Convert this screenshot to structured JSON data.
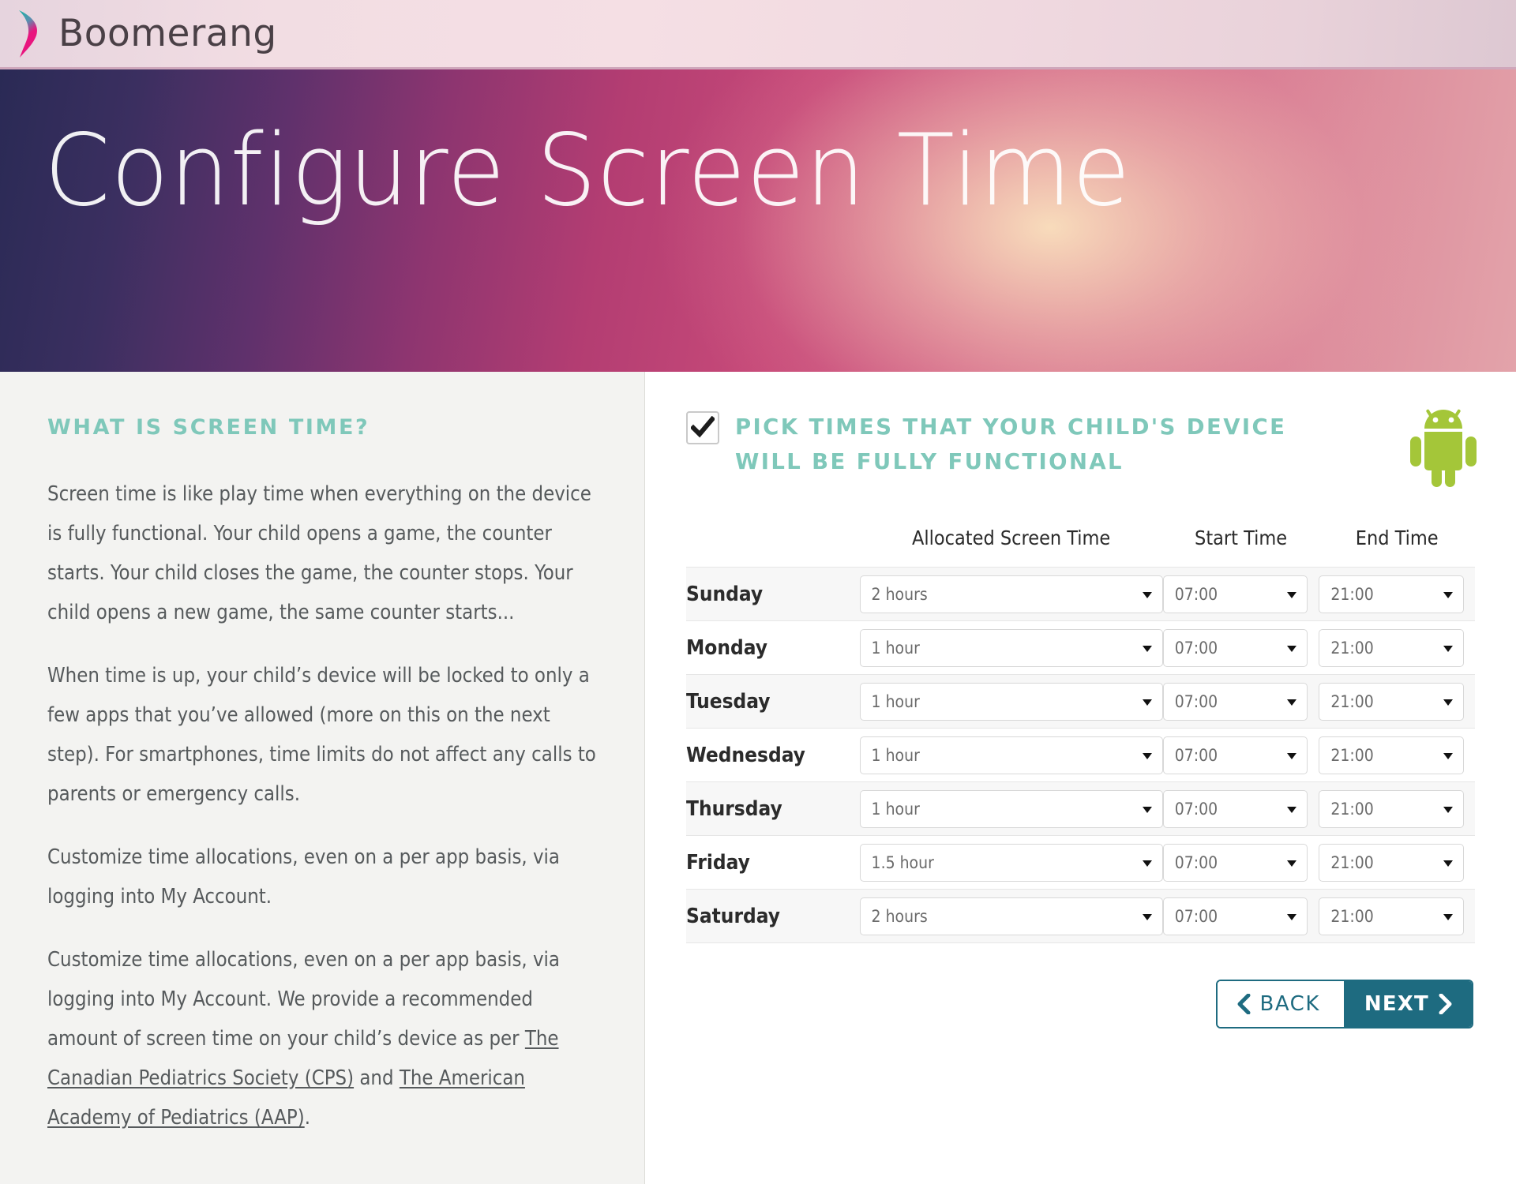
{
  "brand": {
    "name": "Boomerang",
    "logo_icon": "boomerang-crescent-icon"
  },
  "hero": {
    "title": "Configure Screen Time"
  },
  "sidebar": {
    "heading": "WHAT IS SCREEN TIME?",
    "paragraphs": [
      "Screen time is like play time when everything on the device is fully functional. Your child opens a game, the counter starts. Your child closes the game, the counter stops. Your child opens a new game, the same counter starts...",
      "When time is up, your child’s device will be locked to only a few apps that you’ve allowed (more on this on the next step). For smartphones, time limits do not affect any calls to parents or emergency calls.",
      "Customize time allocations, even on a per app basis, via logging into My Account."
    ],
    "last_paragraph": {
      "pre": "Customize time allocations, even on a per app basis, via logging into My Account. We provide a recommended amount of screen time on your child’s device as per ",
      "link1": "The Canadian Pediatrics Society (CPS)",
      "mid": " and ",
      "link2": "The American Academy of Pediatrics (AAP)",
      "post": "."
    }
  },
  "panel": {
    "checkbox_checked": true,
    "checkbox_icon": "checkmark-icon",
    "title": "PICK TIMES THAT YOUR CHILD'S DEVICE WILL BE FULLY FUNCTIONAL",
    "platform_icon": "android-robot-icon",
    "platform_icon_color": "#a4c639"
  },
  "table": {
    "columns": [
      "",
      "Allocated Screen Time",
      "Start Time",
      "End Time"
    ],
    "rows": [
      {
        "day": "Sunday",
        "allocated": "2 hours",
        "start": "07:00",
        "end": "21:00"
      },
      {
        "day": "Monday",
        "allocated": "1 hour",
        "start": "07:00",
        "end": "21:00"
      },
      {
        "day": "Tuesday",
        "allocated": "1 hour",
        "start": "07:00",
        "end": "21:00"
      },
      {
        "day": "Wednesday",
        "allocated": "1 hour",
        "start": "07:00",
        "end": "21:00"
      },
      {
        "day": "Thursday",
        "allocated": "1 hour",
        "start": "07:00",
        "end": "21:00"
      },
      {
        "day": "Friday",
        "allocated": "1.5 hour",
        "start": "07:00",
        "end": "21:00"
      },
      {
        "day": "Saturday",
        "allocated": "2 hours",
        "start": "07:00",
        "end": "21:00"
      }
    ]
  },
  "nav": {
    "back_label": "BACK",
    "next_label": "NEXT",
    "back_icon": "chevron-left-icon",
    "next_icon": "chevron-right-icon",
    "accent_color": "#1e6b80"
  },
  "colors": {
    "teal_heading": "#7fc8ba",
    "body_text": "#565a5c",
    "sidebar_bg": "#f3f3f1"
  }
}
